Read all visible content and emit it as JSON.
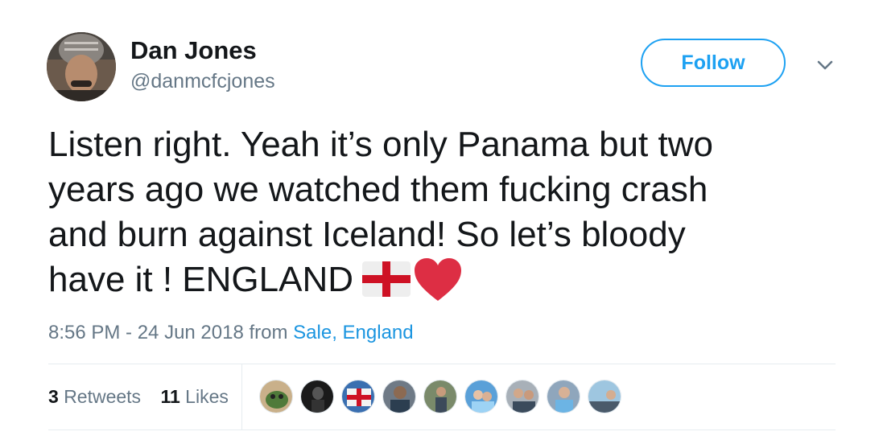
{
  "user": {
    "name": "Dan Jones",
    "handle": "@danmcfcjones"
  },
  "follow": {
    "label": "Follow"
  },
  "tweet": {
    "lines": [
      "Listen right. Yeah it’s only Panama but two",
      "years ago we watched them fucking crash",
      "and burn against Iceland! So let’s bloody",
      "have it ! ENGLAND"
    ],
    "emoji": [
      "england-flag-icon",
      "red-heart-icon"
    ]
  },
  "meta": {
    "time": "8:56 PM - 24 Jun 2018",
    "from": "from",
    "location": "Sale, England"
  },
  "stats": {
    "retweets_count": "3",
    "retweets_label": "Retweets",
    "likes_count": "11",
    "likes_label": "Likes"
  },
  "colors": {
    "accent": "#1da1f2",
    "link": "#1b95e0",
    "muted": "#657786",
    "text": "#14171a",
    "heart": "#dd2e44"
  }
}
